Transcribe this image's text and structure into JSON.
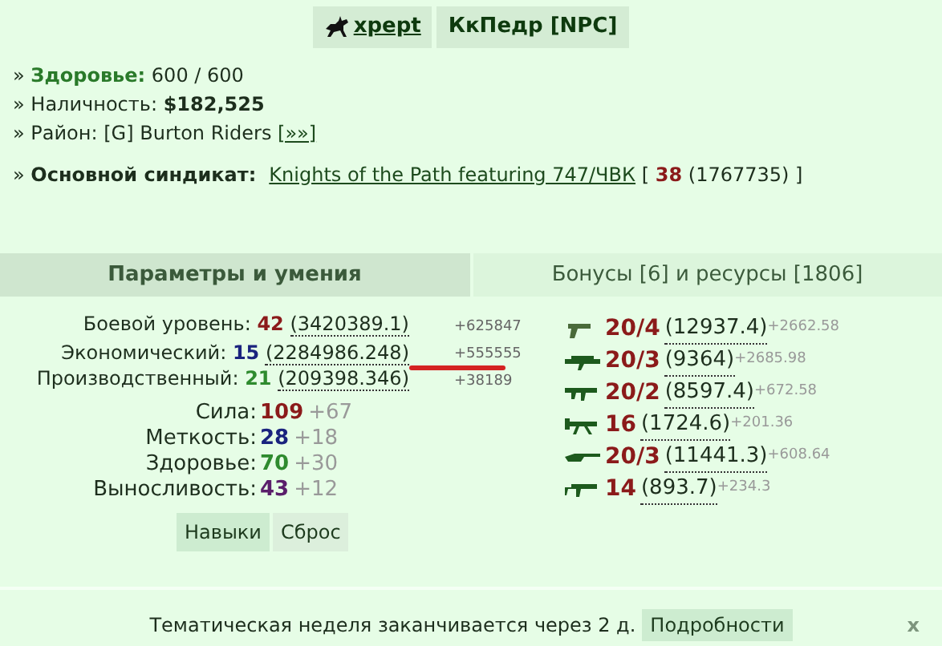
{
  "header": {
    "player": "xpept",
    "npc": "КкПедр [NPC]"
  },
  "info": [
    {
      "kind": "health",
      "bullet": "»",
      "label": "Здоровье:",
      "value": "600 / 600"
    },
    {
      "kind": "cash",
      "bullet": "»",
      "label": "Наличность:",
      "value": "$182,525"
    },
    {
      "kind": "district",
      "bullet": "»",
      "label": "Район:",
      "value": "[G] Burton Riders",
      "link": "[»»]"
    }
  ],
  "syndicate": {
    "bullet": "»",
    "label": "Основной синдикат:",
    "name": "Knights of the Path featuring 747/ЧВК",
    "open": "[",
    "level": "38",
    "points": "(1767735)",
    "close": "]"
  },
  "tabs": [
    {
      "label": "Параметры и умения",
      "selected": true
    },
    {
      "label": "Бонусы [6] и ресурсы [1806]",
      "selected": false
    }
  ],
  "levels": [
    {
      "label": "Боевой уровень:",
      "value": "42",
      "exp": "(3420389.1)",
      "gain": "+625847",
      "color": "#8b1a1a",
      "underlined": false
    },
    {
      "label": "Экономический:",
      "value": "15",
      "exp": "(2284986.248)",
      "gain": "+555555",
      "color": "#1a237e",
      "underlined": true
    },
    {
      "label": "Производственный:",
      "value": "21",
      "exp": "(209398.346)",
      "gain": "+38189",
      "color": "#2e8b2e",
      "underlined": false
    }
  ],
  "stats": [
    {
      "label": "Сила:",
      "value": "109",
      "bonus": "+67",
      "color": "#8b1a1a"
    },
    {
      "label": "Меткость:",
      "value": "28",
      "bonus": "+18",
      "color": "#1a237e"
    },
    {
      "label": "Здоровье:",
      "value": "70",
      "bonus": "+30",
      "color": "#2e8b2e"
    },
    {
      "label": "Выносливость:",
      "value": "43",
      "bonus": "+12",
      "color": "#5b1e6b"
    }
  ],
  "buttons": [
    "Навыки",
    "Сброс"
  ],
  "weapons": [
    {
      "kind": "pistol",
      "level": "20/4",
      "exp": "(12937.4)",
      "gain": "+2662.58"
    },
    {
      "kind": "launcher",
      "level": "20/3",
      "exp": "(9364)",
      "gain": "+2685.98"
    },
    {
      "kind": "smg",
      "level": "20/2",
      "exp": "(8597.4)",
      "gain": "+672.58"
    },
    {
      "kind": "machinegun",
      "level": "16",
      "exp": "(1724.6)",
      "gain": "+201.36"
    },
    {
      "kind": "sniper",
      "level": "20/3",
      "exp": "(11441.3)",
      "gain": "+608.64"
    },
    {
      "kind": "shotgun",
      "level": "14",
      "exp": "(893.7)",
      "gain": "+234.3"
    }
  ],
  "footer": {
    "text": "Тематическая неделя заканчивается через 2 д.",
    "link": "Подробности",
    "close": "x"
  }
}
